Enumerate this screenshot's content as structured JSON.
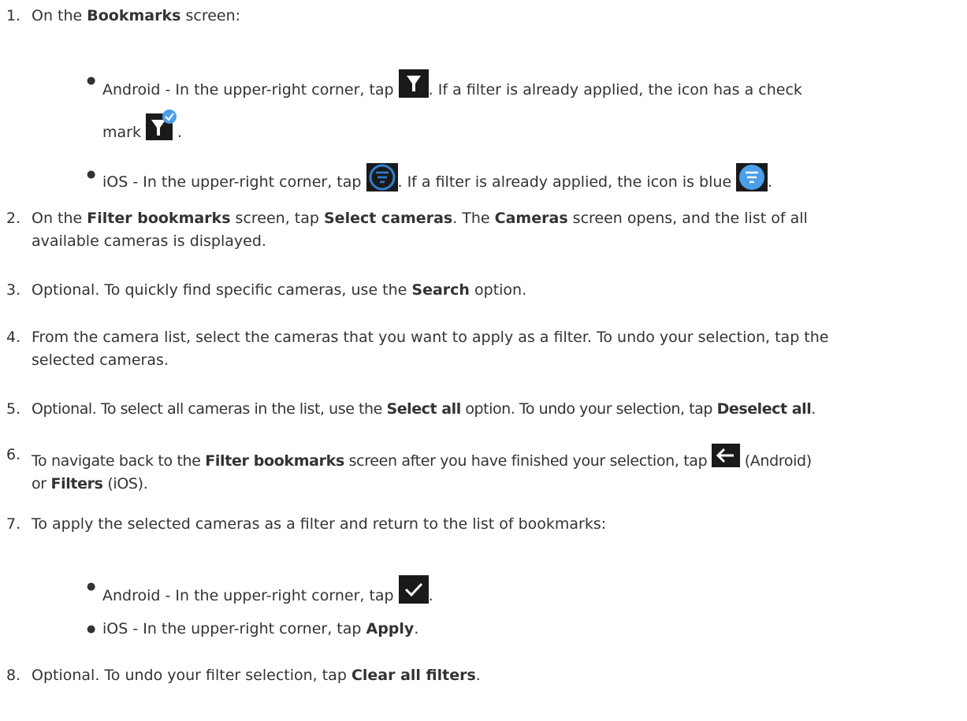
{
  "steps": [
    {
      "num": "1.",
      "lead": "On the ",
      "b1": "Bookmarks",
      "t1": " screen:"
    },
    {
      "num": "2.",
      "t0": "On the ",
      "b1": "Filter bookmarks",
      "t1": " screen, tap ",
      "b2": "Select cameras",
      "t2": ". The ",
      "b3": "Cameras",
      "t3": " screen opens, and the list of all",
      "t4": "available cameras is displayed."
    },
    {
      "num": "3.",
      "t0": "Optional. To quickly find specific cameras, use the ",
      "b1": "Search",
      "t1": " option."
    },
    {
      "num": "4.",
      "t0": "From the camera list, select the cameras that you want to apply as a filter. To undo your selection, tap the",
      "t1": "selected cameras."
    },
    {
      "num": "5.",
      "t0": "Optional. To select all cameras in the list, use the ",
      "b1": "Select all",
      "t1": " option. To undo your selection, tap ",
      "b2": "Deselect all",
      "t2": "."
    },
    {
      "num": "6.",
      "t0": "To navigate back to the ",
      "b1": "Filter bookmarks",
      "t1": " screen after you have finished your selection, tap ",
      "t2": " (Android)",
      "t3": "or ",
      "b2": "Filters",
      "t4": " (iOS)."
    },
    {
      "num": "7.",
      "t0": "To apply the selected cameras as a filter and return to the list of bookmarks:"
    },
    {
      "num": "8.",
      "t0": "Optional. To undo your filter selection, tap ",
      "b1": "Clear all filters",
      "t1": "."
    }
  ],
  "bullets": {
    "android1": {
      "t0": "Android - In the upper-right corner, tap ",
      "t1": ". If a filter is already applied, the icon has a check",
      "t2": "mark ",
      "t3": "."
    },
    "ios1": {
      "t0": "iOS - In the upper-right corner, tap ",
      "t1": ". If a filter is already applied, the icon is blue ",
      "t2": "."
    },
    "android2": {
      "t0": "Android - In the upper-right corner, tap ",
      "t1": "."
    },
    "ios2": {
      "t0": "iOS - In the upper-right corner, tap ",
      "b1": "Apply",
      "t1": "."
    }
  },
  "bullet_glyph": "●",
  "icons": {
    "filter_android": "filter-funnel-icon",
    "filter_android_checked": "filter-funnel-check-icon",
    "filter_ios": "filter-lines-icon",
    "filter_ios_blue": "filter-lines-blue-icon",
    "back_arrow": "back-arrow-icon",
    "checkmark": "checkmark-icon"
  },
  "colors": {
    "text": "#333333",
    "icon_bg": "#1a1a1a",
    "ios_blue": "#4a9fe8",
    "ios_dark_ring": "#2f7fd0"
  }
}
